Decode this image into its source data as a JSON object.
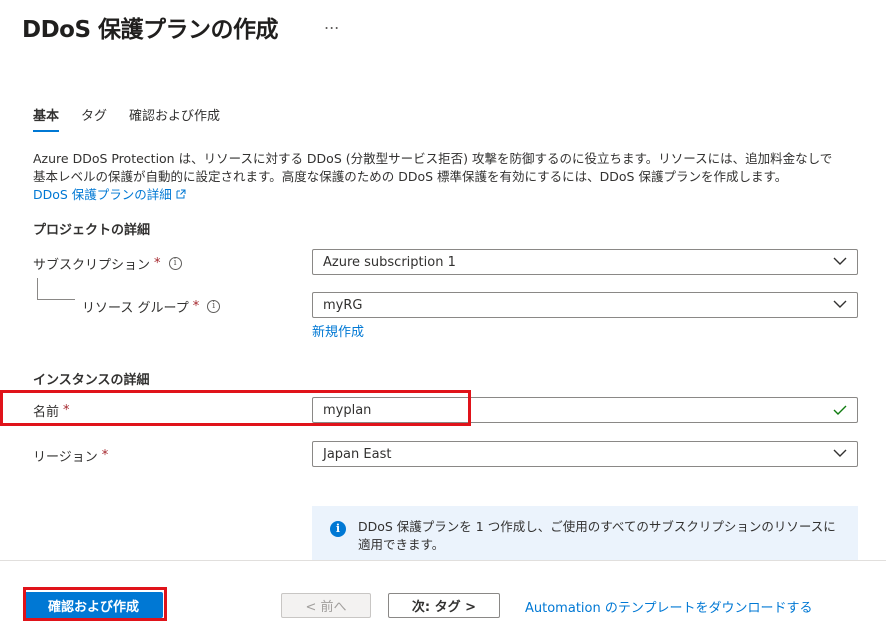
{
  "header": {
    "title": "DDoS 保護プランの作成",
    "more_label": "..."
  },
  "tabs": [
    {
      "label": "基本"
    },
    {
      "label": "タグ"
    },
    {
      "label": "確認および作成"
    }
  ],
  "description": {
    "line1": "Azure DDoS Protection は、リソースに対する DDoS (分散型サービス拒否) 攻撃を防御するのに役立ちます。リソースには、追加料金なしで",
    "line2": "基本レベルの保護が自動的に設定されます。高度な保護のための DDoS 標準保護を有効にするには、DDoS 保護プランを作成します。",
    "link": "DDoS 保護プランの詳細"
  },
  "project": {
    "heading": "プロジェクトの詳細",
    "subscription_label": "サブスクリプション",
    "subscription_value": "Azure subscription 1",
    "resource_group_label": "リソース グループ",
    "resource_group_value": "myRG",
    "create_new_link": "新規作成"
  },
  "instance": {
    "heading": "インスタンスの詳細",
    "name_label": "名前",
    "name_value": "myplan",
    "region_label": "リージョン",
    "region_value": "Japan East"
  },
  "required_mark": "*",
  "info_mark": "i",
  "infobox": {
    "text": "DDoS 保護プランを 1 つ作成し、ご使用のすべてのサブスクリプションのリソースに適用できます。"
  },
  "footer": {
    "review_create": "確認および作成",
    "previous": "< 前へ",
    "next": "次: タグ >",
    "download_template": "Automation のテンプレートをダウンロードする"
  },
  "colors": {
    "accent": "#0078d4",
    "highlight": "#e0131a",
    "valid": "#107c10"
  },
  "icons": {
    "chevron": "chevron-down-icon",
    "check": "checkmark-icon",
    "info": "info-icon",
    "external": "external-link-icon"
  }
}
